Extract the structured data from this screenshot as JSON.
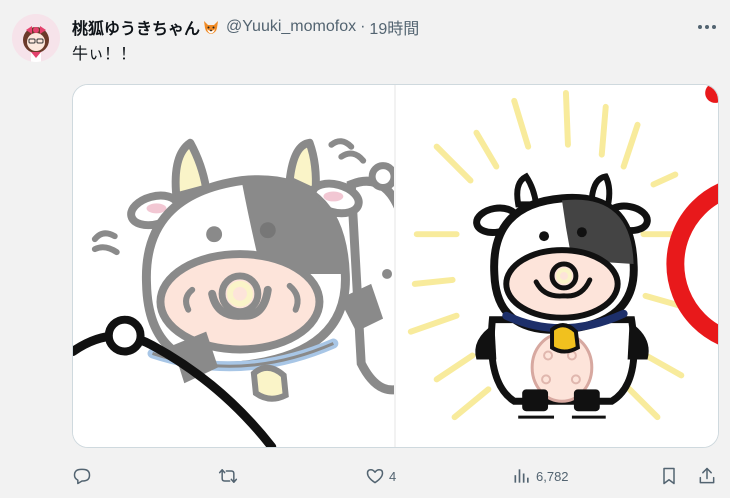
{
  "tweet": {
    "display_name": "桃狐ゆうきちゃん",
    "handle": "@Yuuki_momofox",
    "separator": "·",
    "time": "19時間",
    "text": "牛ぃ！！"
  },
  "actions": {
    "reply_count": "",
    "retweet_count": "",
    "like_count": "4",
    "views_count": "6,782"
  },
  "icons": {
    "more": "more-dots-icon",
    "reply": "reply-icon",
    "retweet": "retweet-icon",
    "like": "heart-icon",
    "views": "views-bar-icon",
    "bookmark": "bookmark-icon",
    "share": "share-icon",
    "fox": "fox-emoji-icon"
  },
  "colors": {
    "icon_gray": "#536471",
    "text": "#0f1419",
    "background": "#f2f2f2",
    "cow_red_ring": "#e8191b",
    "burst_yellow": "#f8eb9c"
  }
}
